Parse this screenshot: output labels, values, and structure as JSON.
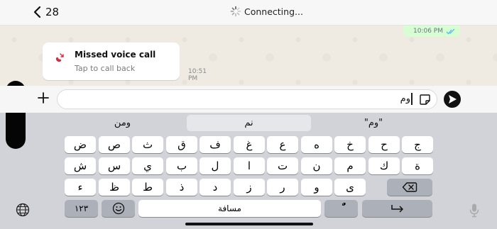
{
  "header": {
    "back_count": "28",
    "status": "Connecting..."
  },
  "chat": {
    "outgoing_time": "10:06 PM",
    "missed_call": {
      "title": "Missed voice call",
      "subtitle": "Tap to call back",
      "time": "10:51 PM"
    }
  },
  "composer": {
    "text": "وم"
  },
  "suggestions": [
    "ومن",
    "نم",
    "\"وم\""
  ],
  "keyboard": {
    "row1": [
      "ض",
      "ص",
      "ث",
      "ق",
      "ف",
      "غ",
      "ع",
      "ه",
      "خ",
      "ح",
      "ج"
    ],
    "row2": [
      "ش",
      "س",
      "ي",
      "ب",
      "ل",
      "ا",
      "ت",
      "ن",
      "م",
      "ك",
      "ة"
    ],
    "row3": [
      "ء",
      "ظ",
      "ط",
      "ذ",
      "د",
      "ز",
      "ر",
      "و",
      "ى"
    ],
    "numbers_label": "١٢٣",
    "space_label": "مسافة",
    "diacritic_label": "ٌّ"
  },
  "colors": {
    "accent_dot": "#f5a623",
    "missed_call_red": "#d52b45",
    "read_ticks": "#53bdeb"
  }
}
